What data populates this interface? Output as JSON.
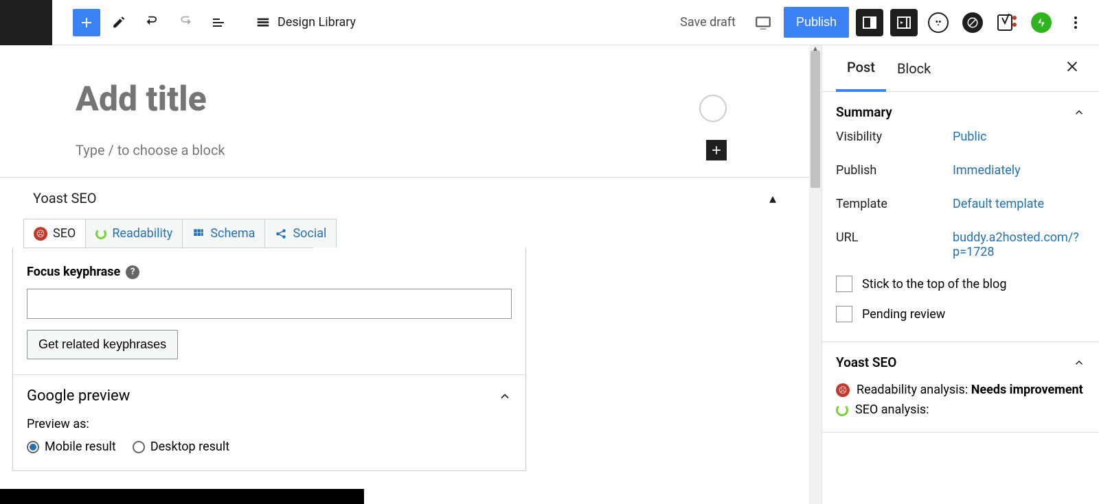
{
  "topbar": {
    "design_library": "Design Library",
    "save_draft": "Save draft",
    "publish": "Publish"
  },
  "editor": {
    "title_placeholder": "Add title",
    "block_prompt": "Type / to choose a block"
  },
  "yoast": {
    "panel_title": "Yoast SEO",
    "tabs": {
      "seo": "SEO",
      "readability": "Readability",
      "schema": "Schema",
      "social": "Social"
    },
    "focus_label": "Focus keyphrase",
    "related_btn": "Get related keyphrases",
    "google_preview": "Google preview",
    "preview_as": "Preview as:",
    "mobile": "Mobile result",
    "desktop": "Desktop result"
  },
  "sidebar": {
    "tabs": {
      "post": "Post",
      "block": "Block"
    },
    "summary": {
      "title": "Summary",
      "rows": {
        "visibility": {
          "k": "Visibility",
          "v": "Public"
        },
        "publish": {
          "k": "Publish",
          "v": "Immediately"
        },
        "template": {
          "k": "Template",
          "v": "Default template"
        },
        "url": {
          "k": "URL",
          "v": "buddy.a2hosted.com/?p=1728"
        }
      },
      "stick": "Stick to the top of the blog",
      "pending": "Pending review"
    },
    "yoast_panel": {
      "title": "Yoast SEO",
      "readability_label": "Readability analysis: ",
      "readability_status": "Needs improvement",
      "seo_label": "SEO analysis:"
    }
  }
}
